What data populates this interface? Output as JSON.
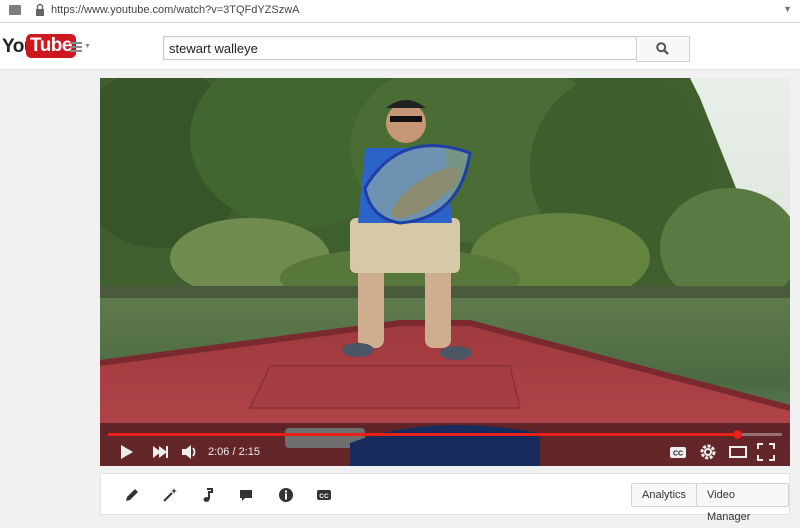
{
  "browser": {
    "url": "https://www.youtube.com/watch?v=3TQFdYZSzwA",
    "url_dropdown_icon": "dropdown-caret-icon"
  },
  "header": {
    "logo_you": "You",
    "logo_tube": "Tube",
    "search_value": "stewart walleye",
    "brand_color": "#cc181e"
  },
  "player": {
    "current_time": "2:06",
    "separator": "/",
    "duration": "2:15",
    "progress_fraction": 0.933,
    "progress_color": "#e62117",
    "controls": [
      "play-icon",
      "next-icon",
      "volume-icon",
      "captions-icon",
      "settings-icon",
      "theater-icon",
      "fullscreen-icon"
    ]
  },
  "action_bar": {
    "icons": [
      "pencil-icon",
      "magic-wand-icon",
      "music-note-icon",
      "comment-icon",
      "info-icon",
      "captions-icon"
    ],
    "analytics_label": "Analytics",
    "video_manager_label": "Video Manager"
  }
}
